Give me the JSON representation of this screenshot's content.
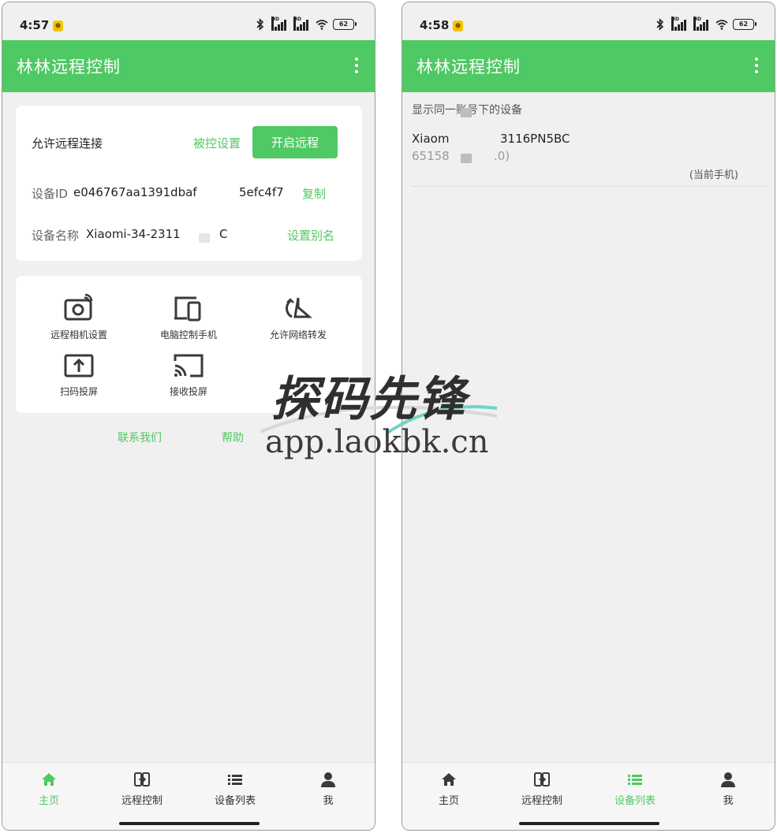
{
  "colors": {
    "accent": "#4fc963",
    "background": "#f0f0f0",
    "card": "#ffffff"
  },
  "left": {
    "status": {
      "time": "4:57",
      "battery": "62",
      "badge": "HD"
    },
    "app_title": "林林远程控制",
    "remote": {
      "allow_label": "允许远程连接",
      "controlled_settings": "被控设置",
      "enable_button": "开启远程",
      "device_id_key": "设备ID",
      "device_id_value_a": "e046767aa1391dbaf",
      "device_id_value_b": "5efc4f7",
      "copy_link": "复制",
      "device_name_key": "设备名称",
      "device_name_value": "Xiaomi-34-2311",
      "device_name_tail": "C",
      "alias_link": "设置别名"
    },
    "tools": [
      {
        "label": "远程相机设置",
        "icon": "camera-icon"
      },
      {
        "label": "电脑控制手机",
        "icon": "devices-icon"
      },
      {
        "label": "允许网络转发",
        "icon": "network-forward-icon"
      },
      {
        "label": "扫码投屏",
        "icon": "upload-screen-icon"
      },
      {
        "label": "接收投屏",
        "icon": "cast-icon"
      }
    ],
    "links": {
      "contact": "联系我们",
      "help": "帮助"
    }
  },
  "right": {
    "status": {
      "time": "4:58",
      "battery": "62",
      "badge": "HD"
    },
    "app_title": "林林远程控制",
    "list_hint": "显示同一账号下的设备",
    "device": {
      "name_a": "Xiaom",
      "name_b": "3116PN5BC",
      "sub_a": "65158",
      "sub_b": ".0)",
      "tag": "(当前手机)"
    }
  },
  "tabs": [
    {
      "label": "主页",
      "icon": "home-icon"
    },
    {
      "label": "远程控制",
      "icon": "remote-control-icon"
    },
    {
      "label": "设备列表",
      "icon": "list-icon"
    },
    {
      "label": "我",
      "icon": "person-icon"
    }
  ],
  "watermark": {
    "title": "探码先锋",
    "url": "app.laokbk.cn"
  }
}
